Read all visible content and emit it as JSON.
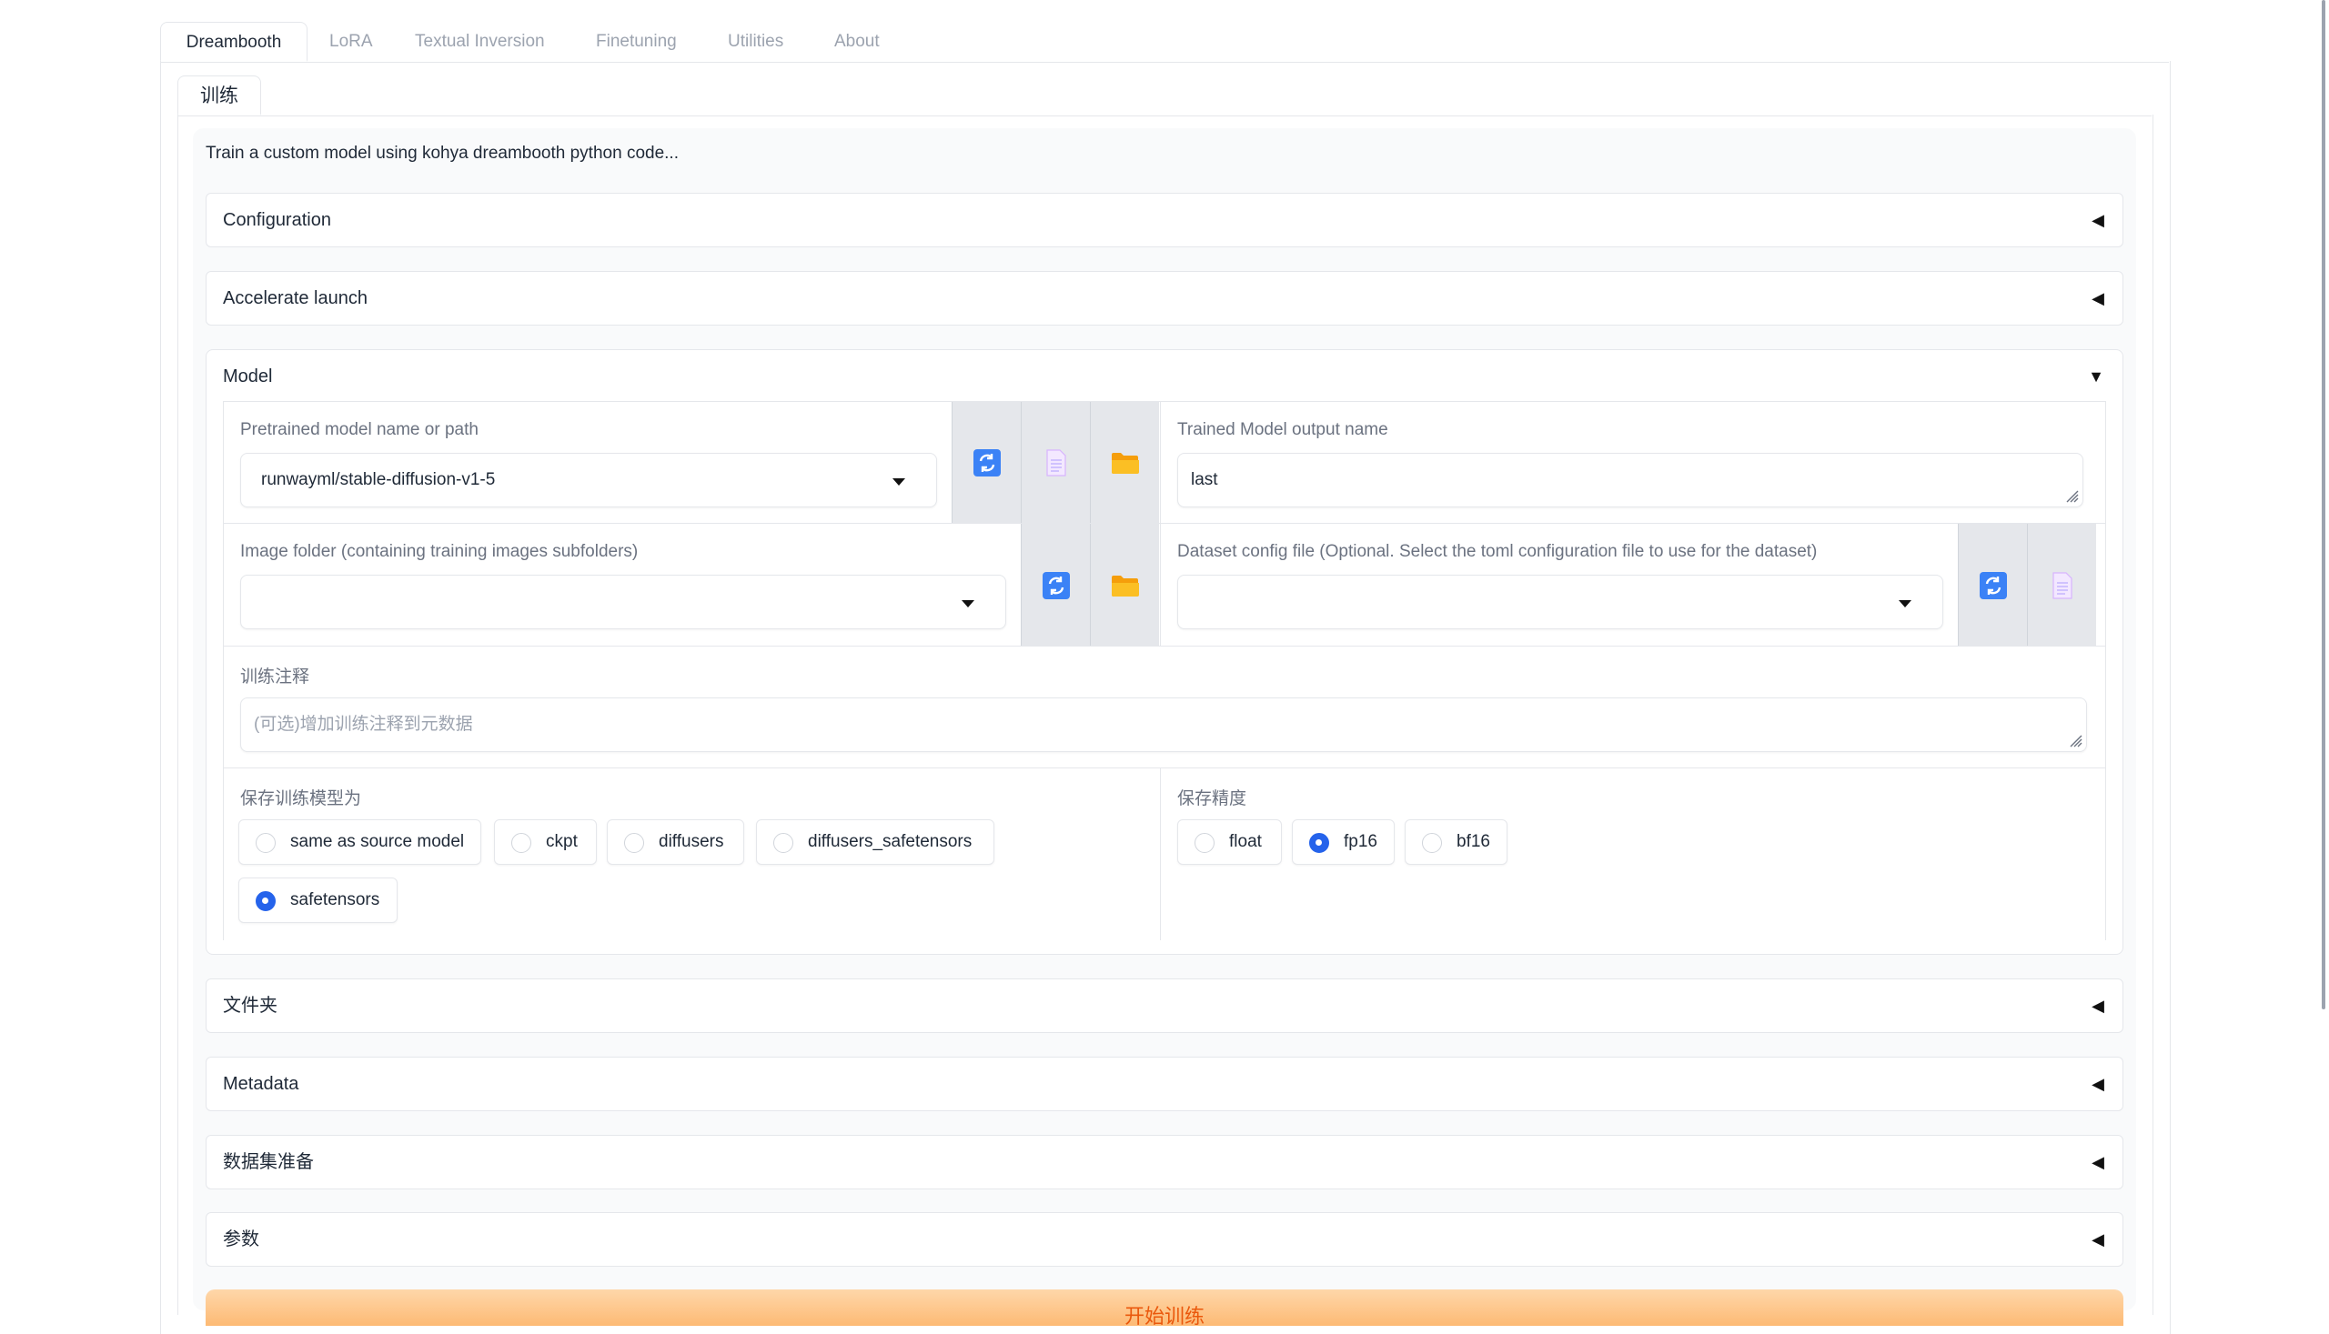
{
  "tabs": [
    "Dreambooth",
    "LoRA",
    "Textual Inversion",
    "Finetuning",
    "Utilities",
    "About"
  ],
  "subtab": "训练",
  "description": "Train a custom model using kohya dreambooth python code...",
  "accordions": {
    "configuration": "Configuration",
    "accelerate": "Accelerate launch",
    "folders": "文件夹",
    "metadata": "Metadata",
    "dataset_prep": "数据集准备",
    "params": "参数"
  },
  "arrows": {
    "collapsed": "◀",
    "expanded": "▼"
  },
  "model": {
    "title": "Model",
    "pretrained_label": "Pretrained model name or path",
    "pretrained_value": "runwayml/stable-diffusion-v1-5",
    "output_name_label": "Trained Model output name",
    "output_name_value": "last",
    "image_folder_label": "Image folder (containing training images subfolders)",
    "image_folder_value": "",
    "dataset_config_label": "Dataset config file (Optional. Select the toml configuration file to use for the dataset)",
    "dataset_config_value": "",
    "comment_label": "训练注释",
    "comment_placeholder": "(可选)增加训练注释到元数据",
    "save_as_label": "保存训练模型为",
    "save_as_options": [
      "same as source model",
      "ckpt",
      "diffusers",
      "diffusers_safetensors",
      "safetensors"
    ],
    "save_as_selected": "safetensors",
    "precision_label": "保存精度",
    "precision_options": [
      "float",
      "fp16",
      "bf16"
    ],
    "precision_selected": "fp16"
  },
  "run_button": "开始训练",
  "colors": {
    "accent": "#2563eb",
    "refresh_icon": "#3b82f6",
    "folder_icon": "#f59e0b",
    "run_button": "#fdba74"
  },
  "icons": [
    "refresh-icon",
    "document-icon",
    "folder-icon"
  ]
}
